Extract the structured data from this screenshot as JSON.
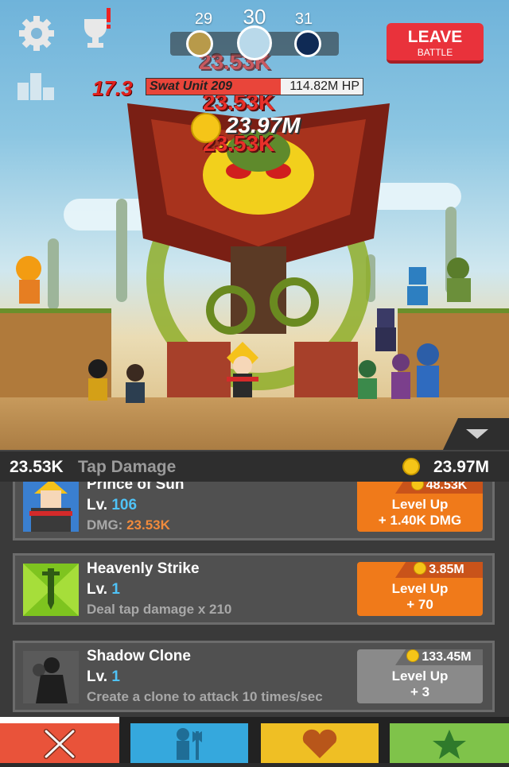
{
  "stages": {
    "prev": "29",
    "current": "30",
    "next": "31"
  },
  "leave": {
    "line1": "LEAVE",
    "line2": "BATTLE"
  },
  "boss": {
    "timer": "17.3",
    "name": "Swat Unit 209",
    "hp": "114.82M HP",
    "hp_fraction": 0.62
  },
  "floating": {
    "dmg1": "23.53K",
    "dmg2": "23.53K",
    "dmg3": "23.53K",
    "gold": "23.97M"
  },
  "stats": {
    "tap_damage_value": "23.53K",
    "tap_damage_label": "Tap Damage",
    "gold": "23.97M"
  },
  "rows": [
    {
      "name": "Prince of Sun",
      "level_label": "Lv.",
      "level": "106",
      "desc_label": "DMG:",
      "desc_value": "23.53K",
      "cost": "48.53K",
      "btn_line1": "Level Up",
      "btn_line2": "+ 1.40K DMG"
    },
    {
      "name": "Heavenly Strike",
      "level_label": "Lv.",
      "level": "1",
      "desc": "Deal tap damage x 210",
      "cost": "3.85M",
      "btn_line1": "Level Up",
      "btn_line2": "+ 70"
    },
    {
      "name": "Shadow Clone",
      "level_label": "Lv.",
      "level": "1",
      "desc": "Create a clone to attack 10 times/sec",
      "cost": "133.45M",
      "btn_line1": "Level Up",
      "btn_line2": "+ 3"
    }
  ],
  "tabs": [
    "sword-icon",
    "hero-axe-icon",
    "heart-icon",
    "star-icon"
  ],
  "colors": {
    "orange": "#f07a1a",
    "gray_btn": "#8a8a8a",
    "tab1": "#e9533a",
    "tab2": "#35a8dd",
    "tab3": "#efbf24",
    "tab4": "#7fc34a"
  }
}
